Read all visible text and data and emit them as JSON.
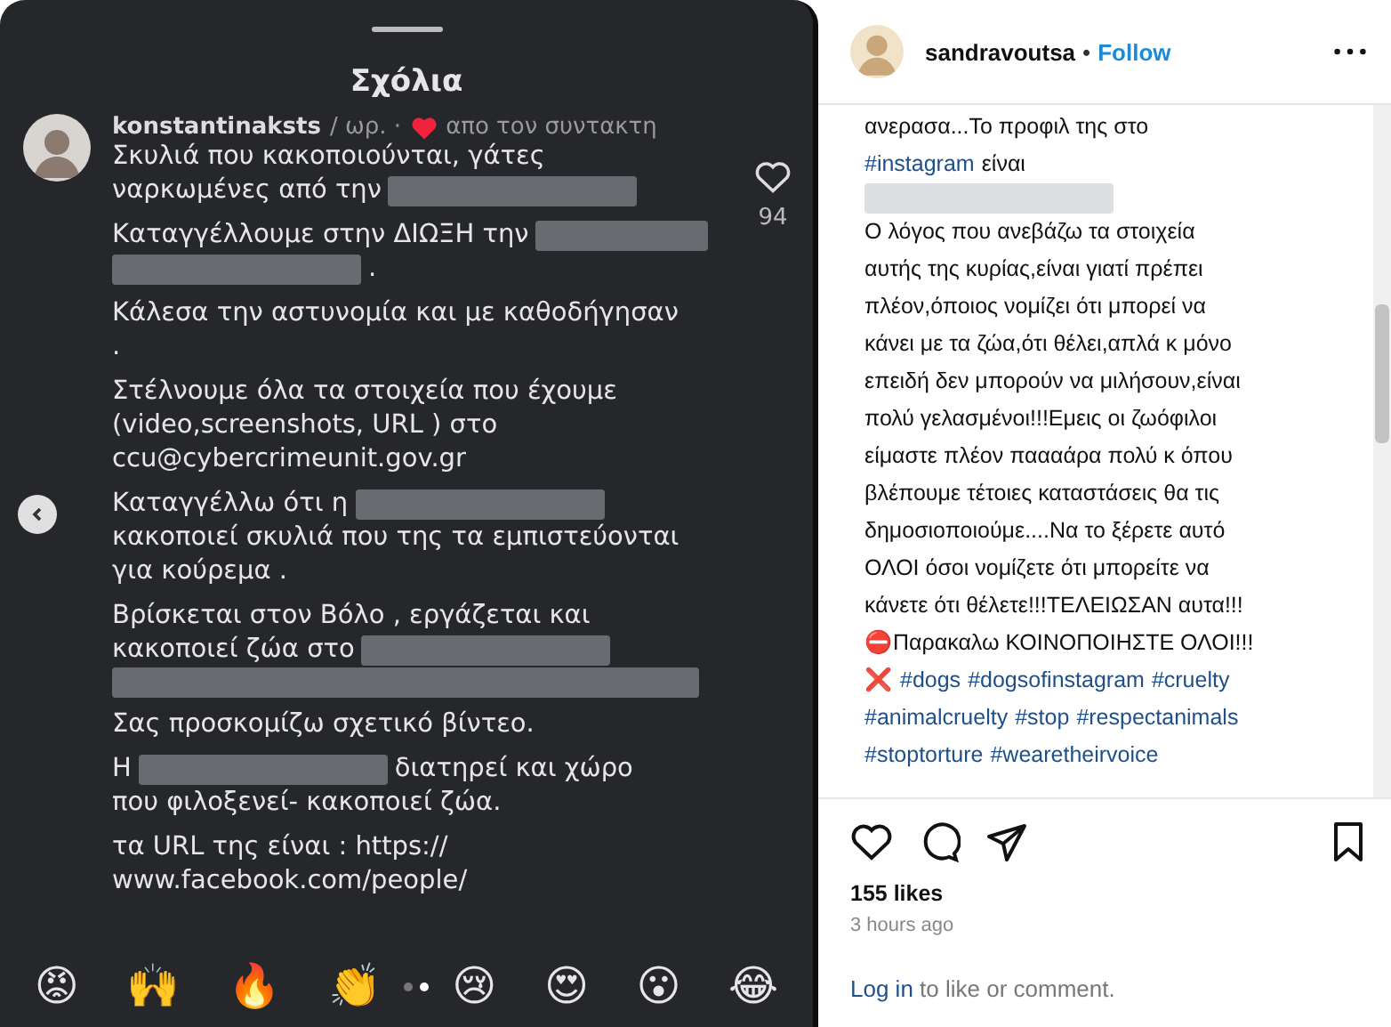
{
  "comments_sheet": {
    "title": "Σχόλια",
    "comment": {
      "username": "konstantinaksts",
      "meta": "/ ωρ. ·",
      "author_liked": true,
      "author_note": "απο τον συντακτη",
      "like_count": "94",
      "paragraphs": [
        [
          [
            {
              "kind": "text",
              "text": "Σκυλιά που κακοποιούνται, γάτες"
            }
          ],
          [
            {
              "kind": "text",
              "text": "ναρκωμένες από την"
            },
            {
              "kind": "redacted"
            }
          ]
        ],
        [
          [
            {
              "kind": "text",
              "text": "Καταγγέλλουμε στην ΔΙΩΞΗ την"
            },
            {
              "kind": "redacted"
            }
          ],
          [
            {
              "kind": "redacted"
            },
            {
              "kind": "text",
              "text": "."
            }
          ]
        ],
        [
          [
            {
              "kind": "text",
              "text": "Κάλεσα την αστυνομία και με καθοδήγησαν"
            }
          ],
          [
            {
              "kind": "text",
              "text": "."
            }
          ]
        ],
        [
          [
            {
              "kind": "text",
              "text": "Στέλνουμε όλα τα στοιχεία που έχουμε"
            }
          ],
          [
            {
              "kind": "text",
              "text": "(video,screenshots, URL ) στο"
            }
          ],
          [
            {
              "kind": "text",
              "text": "ccu@cybercrimeunit.gov.gr"
            }
          ]
        ],
        [
          [
            {
              "kind": "text",
              "text": "Καταγγέλλω ότι η"
            },
            {
              "kind": "redacted"
            }
          ],
          [
            {
              "kind": "text",
              "text": "κακοποιεί σκυλιά που της τα εμπιστεύονται"
            }
          ],
          [
            {
              "kind": "text",
              "text": "για κούρεμα ."
            }
          ]
        ],
        [
          [
            {
              "kind": "text",
              "text": "Βρίσκεται στον Βόλο , εργάζεται και"
            }
          ],
          [
            {
              "kind": "text",
              "text": "κακοποιεί ζώα στο"
            },
            {
              "kind": "redacted"
            }
          ],
          [
            {
              "kind": "redacted_line"
            }
          ]
        ],
        [
          [
            {
              "kind": "text",
              "text": "Σας προσκομίζω σχετικό βίντεο."
            }
          ]
        ],
        [
          [
            {
              "kind": "text",
              "text": "Η"
            },
            {
              "kind": "redacted"
            },
            {
              "kind": "text",
              "text": "διατηρεί και χώρο"
            }
          ],
          [
            {
              "kind": "text",
              "text": "που φιλοξενεί- κακοποιεί ζώα."
            }
          ]
        ],
        [
          [
            {
              "kind": "text",
              "text": "τα URL της είναι : https://"
            }
          ],
          [
            {
              "kind": "text",
              "text": "www.facebook.com/people/"
            }
          ]
        ]
      ]
    },
    "reactions": [
      "😡",
      "🙌",
      "🔥",
      "👏",
      "😢",
      "😍",
      "😮",
      "😂"
    ],
    "pages": [
      {
        "selected": false
      },
      {
        "selected": true
      }
    ]
  },
  "post": {
    "username": "sandravoutsa",
    "separator": "•",
    "follow": "Follow",
    "caption": [
      [
        {
          "kind": "text",
          "text": "ανερασα...Το προφιλ της στο"
        }
      ],
      [
        {
          "kind": "hashtag",
          "text": "#instagram"
        },
        {
          "kind": "text",
          "text": "είναι"
        }
      ],
      [
        {
          "kind": "redacted"
        }
      ],
      [
        {
          "kind": "text",
          "text": "Ο λόγος που ανεβάζω τα στοιχεία"
        }
      ],
      [
        {
          "kind": "text",
          "text": "αυτής της κυρίας,είναι γιατί πρέπει"
        }
      ],
      [
        {
          "kind": "text",
          "text": "πλέον,όποιος νομίζει ότι μπορεί να"
        }
      ],
      [
        {
          "kind": "text",
          "text": "κάνει με τα ζώα,ότι θέλει,απλά κ μόνο"
        }
      ],
      [
        {
          "kind": "text",
          "text": "επειδή δεν μπορούν να μιλήσουν,είναι"
        }
      ],
      [
        {
          "kind": "text",
          "text": "πολύ γελασμένοι!!!Εμεις οι ζωόφιλοι"
        }
      ],
      [
        {
          "kind": "text",
          "text": "είμαστε πλέον παααάρα πολύ κ όπου"
        }
      ],
      [
        {
          "kind": "text",
          "text": "βλέπουμε τέτοιες καταστάσεις θα τις"
        }
      ],
      [
        {
          "kind": "text",
          "text": "δημοσιοποιούμε....Να το ξέρετε αυτό"
        }
      ],
      [
        {
          "kind": "text",
          "text": "ΟΛΟΙ όσοι νομίζετε ότι μπορείτε να"
        }
      ],
      [
        {
          "kind": "text",
          "text": "κάνετε ότι θέλετε!!!ΤΕΛΕΙΩΣΑΝ αυτα!!!"
        }
      ],
      [
        {
          "kind": "text",
          "text": "⛔Παρακαλω ΚΟΙΝΟΠΟΙΗΣΤΕ ΟΛΟΙ!!!"
        }
      ],
      [
        {
          "kind": "text",
          "text": "❌"
        },
        {
          "kind": "hashtag",
          "text": "#dogs"
        },
        {
          "kind": "hashtag",
          "text": "#dogsofinstagram"
        },
        {
          "kind": "hashtag",
          "text": "#cruelty"
        }
      ],
      [
        {
          "kind": "hashtag",
          "text": "#animalcruelty"
        },
        {
          "kind": "hashtag",
          "text": "#stop"
        },
        {
          "kind": "hashtag",
          "text": "#respectanimals"
        }
      ],
      [
        {
          "kind": "hashtag",
          "text": "#stoptorture"
        },
        {
          "kind": "hashtag",
          "text": "#wearetheirvoice"
        }
      ]
    ],
    "likes": "155 likes",
    "time": "3 hours ago",
    "login_link": "Log in",
    "login_rest": " to like or comment."
  }
}
